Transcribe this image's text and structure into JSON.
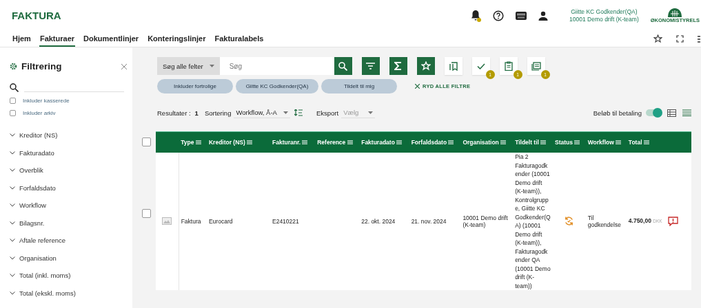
{
  "app_title": "FAKTURA",
  "user": {
    "name": "Giitte KC Godkender(QA)",
    "org": "10001 Demo drift (K-team)"
  },
  "logo_text": "ØKONOMISTYRELS",
  "tabs": [
    {
      "label": "Hjem",
      "selected": false
    },
    {
      "label": "Fakturaer",
      "selected": true
    },
    {
      "label": "Dokumentlinjer",
      "selected": false
    },
    {
      "label": "Konteringslinjer",
      "selected": false
    },
    {
      "label": "Fakturalabels",
      "selected": false
    }
  ],
  "sidebar": {
    "title": "Filtrering",
    "checkboxes": [
      {
        "label": "Inkluder kasserede",
        "checked": false
      },
      {
        "label": "Inkluder arkiv",
        "checked": false
      }
    ],
    "sections": [
      "Kreditor (NS)",
      "Fakturadato",
      "Overblik",
      "Forfaldsdato",
      "Workflow",
      "Bilagsnr.",
      "Aftale reference",
      "Organisation",
      "Total (inkl. moms)",
      "Total (ekskl. moms)"
    ]
  },
  "search": {
    "scope": "Søg alle felter",
    "placeholder": "Søg"
  },
  "toolbar_badges": [
    "1",
    "1",
    "1"
  ],
  "chips": [
    "Inkluder fortrolige",
    "Giitte KC Godkender(QA)",
    "Tildelt til mig"
  ],
  "clear_filters": "RYD ALLE FILTRE",
  "results": {
    "label": "Resultater :",
    "count": "1",
    "sort_label": "Sortering",
    "sort_value": "Workflow, Å-A",
    "export_label": "Eksport",
    "export_placeholder": "Vælg",
    "toggle_label": "Beløb til betaling",
    "toggle_on": true
  },
  "table": {
    "select_all_checked": false,
    "columns": [
      "Type",
      "Kreditor (NS)",
      "Fakturanr.",
      "Reference",
      "Fakturadato",
      "Forfaldsdato",
      "Organisation",
      "Tildelt til",
      "Status",
      "Workflow",
      "Total"
    ],
    "rows": [
      {
        "checked": false,
        "type": "Faktura",
        "kreditor": "Eurocard",
        "fakturanr": "E2410221",
        "fakturadato": "22. okt. 2024",
        "forfaldsdato": "21. nov. 2024",
        "organisation": "10001 Demo drift (K-team)",
        "tildelt": "Pia 2 Fakturagodkender (10001 Demo drift (K-team)), Kontrolgruppe, Giitte KC Godkender(QA) (10001 Demo drift (K-team)), Fakturagodkender QA (10001 Demo drift (K-team))",
        "workflow": "Til godkendelse",
        "total": "4.750,00",
        "currency": "DKK"
      }
    ]
  }
}
